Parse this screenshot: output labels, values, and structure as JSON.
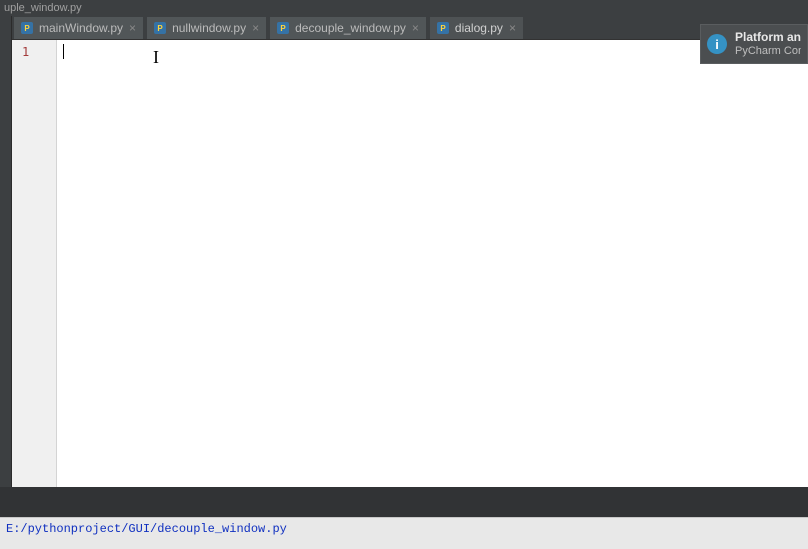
{
  "breadcrumb": "uple_window.py",
  "tabs": [
    {
      "label": "mainWindow.py",
      "active": false
    },
    {
      "label": "nullwindow.py",
      "active": false
    },
    {
      "label": "decouple_window.py",
      "active": false
    },
    {
      "label": "dialog.py",
      "active": true
    }
  ],
  "editor": {
    "line_number": "1",
    "content": ""
  },
  "notification": {
    "title": "Platform and",
    "subtitle": "PyCharm Com"
  },
  "status_bar": {
    "path": "E:/pythonproject/GUI/decouple_window.py"
  }
}
